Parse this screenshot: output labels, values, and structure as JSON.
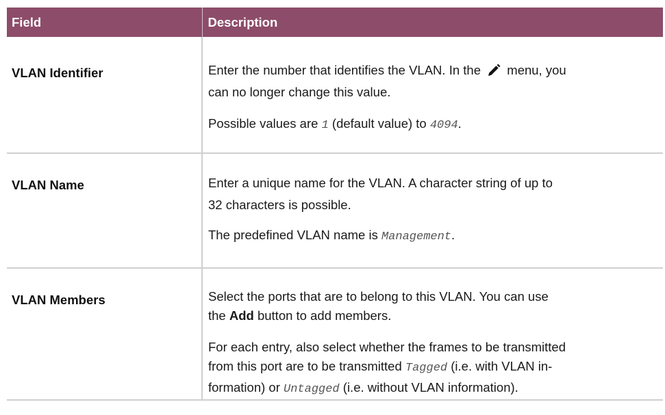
{
  "table": {
    "header": {
      "field": "Field",
      "description": "Description"
    },
    "rows": [
      {
        "field": "VLAN Identifier",
        "p1_a": "Enter the number that identifies the VLAN. In the",
        "p1_icon": "pencil-icon",
        "p1_b": "menu, you",
        "p1_c": "can no longer change this value.",
        "p2_a": "Possible values are",
        "p2_v1": "1",
        "p2_b": "(default value) to",
        "p2_v2": "4094",
        "p2_c": "."
      },
      {
        "field": "VLAN Name",
        "p1_a": "Enter a unique name for the VLAN. A character string of up to",
        "p1_b": "32 characters is possible.",
        "p2_a": "The predefined VLAN name is",
        "p2_v1": "Management",
        "p2_c": "."
      },
      {
        "field": "VLAN Members",
        "p1_a": "Select the ports that are to belong to this VLAN. You can use",
        "p1_b_pre": "the",
        "p1_b_bold": "Add",
        "p1_b_post": "button to add members.",
        "p2_a": "For each entry, also select whether the frames to be transmitted",
        "p2_b": "from this port are to be transmitted",
        "p2_v1": "Tagged",
        "p2_c": "(i.e. with VLAN in-",
        "p2_d": "formation) or",
        "p2_v2": "Untagged",
        "p2_e": "(i.e. without VLAN information)."
      }
    ]
  }
}
